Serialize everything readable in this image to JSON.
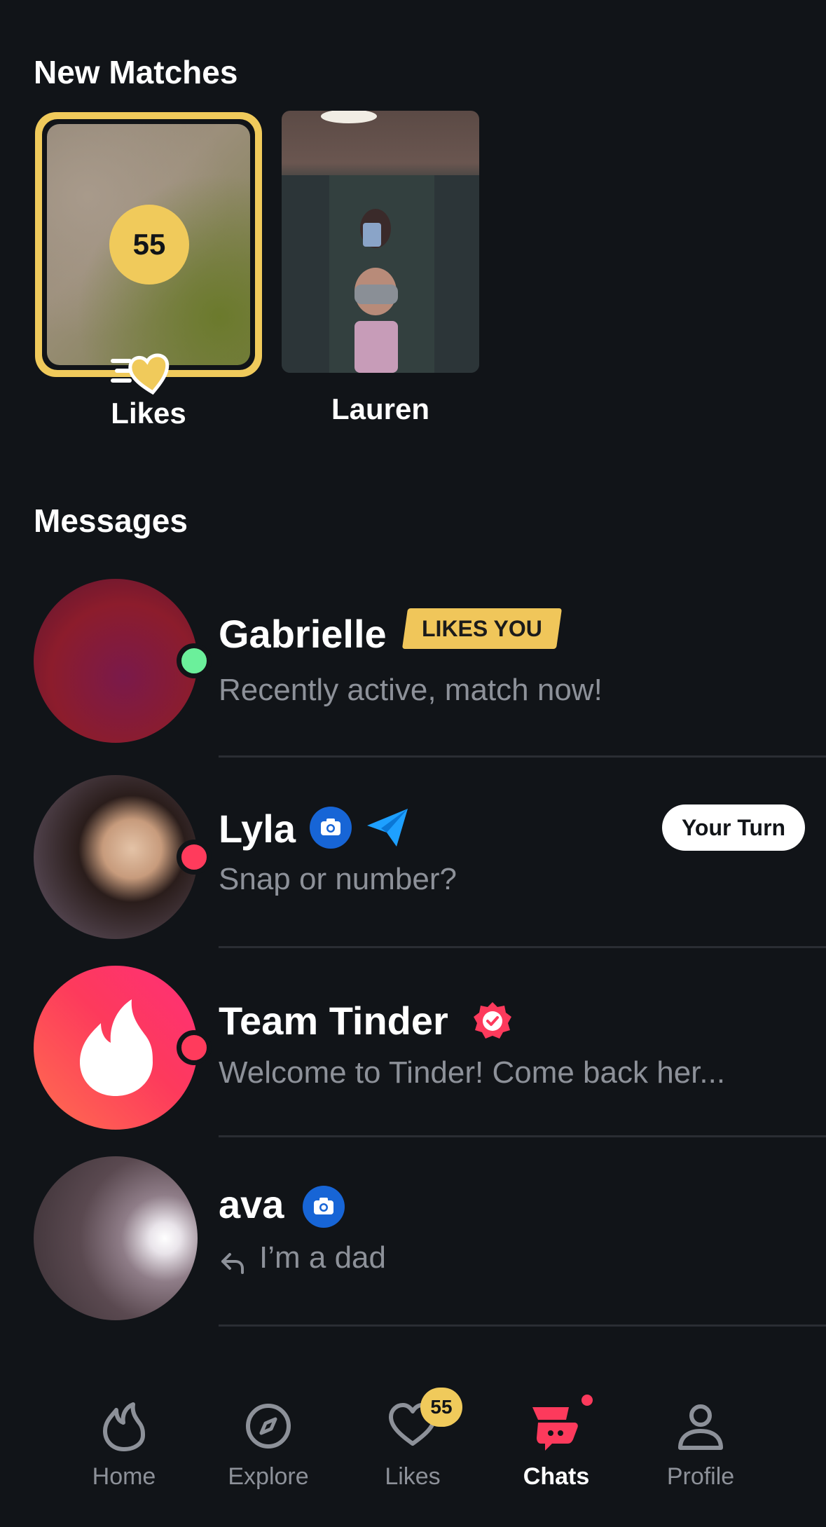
{
  "new_matches": {
    "title": "New Matches",
    "likes_card": {
      "count": "55",
      "label": "Likes"
    },
    "matches": [
      {
        "name": "Lauren"
      }
    ]
  },
  "messages": {
    "title": "Messages",
    "rows": [
      {
        "name": "Gabrielle",
        "badge": "LIKES YOU",
        "preview": "Recently active, match now!",
        "status_color": "#6bf09b"
      },
      {
        "name": "Lyla",
        "tag": "Your Turn",
        "preview": "Snap or number?",
        "status_color": "#ff3b5c"
      },
      {
        "name": "Team Tinder",
        "preview": "Welcome to Tinder! Come back her...",
        "status_color": "#ff3b5c"
      },
      {
        "name": "ava",
        "preview": "I’m a dad"
      }
    ]
  },
  "bottom_nav": {
    "items": [
      {
        "label": "Home"
      },
      {
        "label": "Explore"
      },
      {
        "label": "Likes",
        "badge": "55"
      },
      {
        "label": "Chats",
        "active": true
      },
      {
        "label": "Profile"
      }
    ]
  },
  "colors": {
    "background": "#111418",
    "gold": "#f0ca5b",
    "tinder_red": "#fd3a5c",
    "muted": "#8d9199"
  }
}
